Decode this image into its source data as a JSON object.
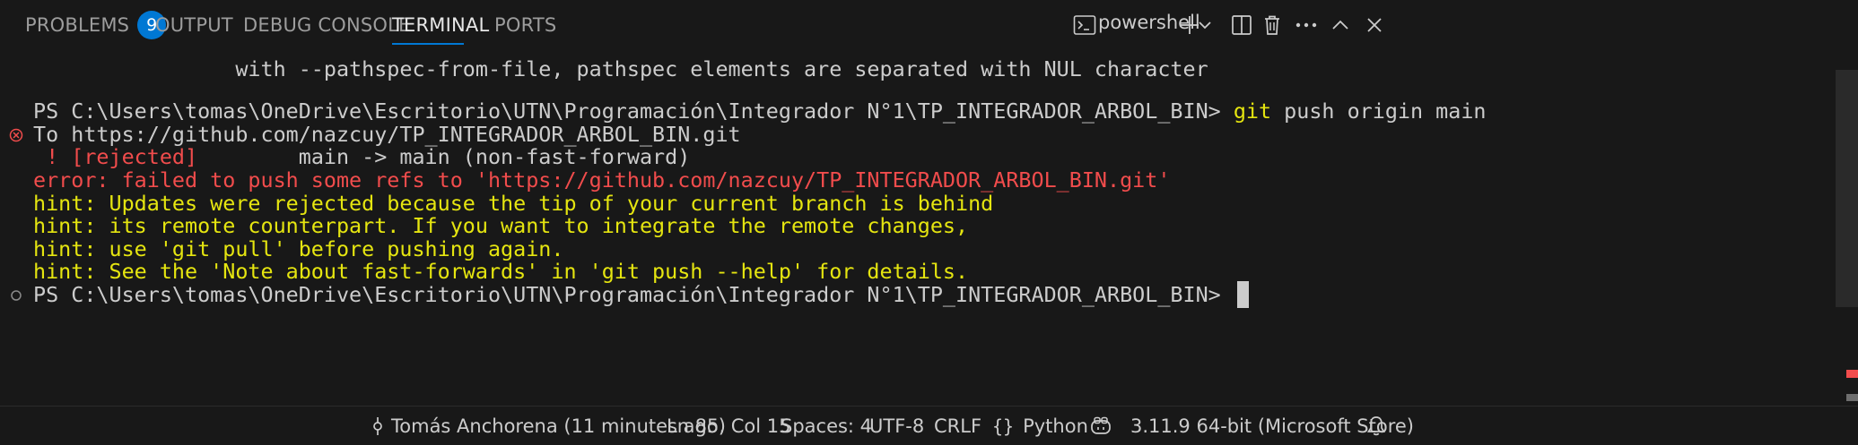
{
  "tabs": [
    {
      "label": "PROBLEMS",
      "badge": "9"
    },
    {
      "label": "OUTPUT"
    },
    {
      "label": "DEBUG CONSOLE"
    },
    {
      "label": "TERMINAL",
      "active": true
    },
    {
      "label": "PORTS"
    }
  ],
  "actions": {
    "shell_name": "powershell",
    "icons": [
      "terminal-icon",
      "plus-icon",
      "chevron-down-icon",
      "split-icon",
      "trash-icon",
      "more-icon",
      "chevron-up-icon",
      "close-icon"
    ]
  },
  "terminal": {
    "lines": [
      {
        "text": "                with --pathspec-from-file, pathspec elements are separated with NUL character",
        "color": "default"
      },
      {
        "text": "",
        "color": "default"
      },
      {
        "prompt": "PS C:\\Users\\tomas\\OneDrive\\Escritorio\\UTN\\Programación\\Integrador N°1\\TP_INTEGRADOR_ARBOL_BIN> ",
        "cmd": "git",
        "args": " push origin main",
        "decoration": "error"
      },
      {
        "text": "To https://github.com/nazcuy/TP_INTEGRADOR_ARBOL_BIN.git",
        "color": "default"
      },
      {
        "text_red": " ! [rejected]",
        "text": "        main -> main (non-fast-forward)"
      },
      {
        "text": "error: failed to push some refs to 'https://github.com/nazcuy/TP_INTEGRADOR_ARBOL_BIN.git'",
        "color": "red"
      },
      {
        "text": "hint: Updates were rejected because the tip of your current branch is behind",
        "color": "yellow"
      },
      {
        "text": "hint: its remote counterpart. If you want to integrate the remote changes,",
        "color": "yellow"
      },
      {
        "text": "hint: use 'git pull' before pushing again.",
        "color": "yellow"
      },
      {
        "text": "hint: See the 'Note about fast-forwards' in 'git push --help' for details.",
        "color": "yellow"
      },
      {
        "prompt": "PS C:\\Users\\tomas\\OneDrive\\Escritorio\\UTN\\Programación\\Integrador N°1\\TP_INTEGRADOR_ARBOL_BIN> ",
        "decoration": "empty",
        "cursor": true
      }
    ]
  },
  "status_bar": {
    "blame": "Tomás Anchorena (11 minutes ago)",
    "position": "Ln 85, Col 15",
    "spaces": "Spaces: 4",
    "encoding": "UTF-8",
    "eol": "CRLF",
    "language": "Python",
    "interpreter": "3.11.9 64-bit (Microsoft Store)"
  },
  "colors": {
    "accent": "#0078d4",
    "error": "#f14c4c",
    "hint": "#e5e510",
    "background": "#181818"
  }
}
